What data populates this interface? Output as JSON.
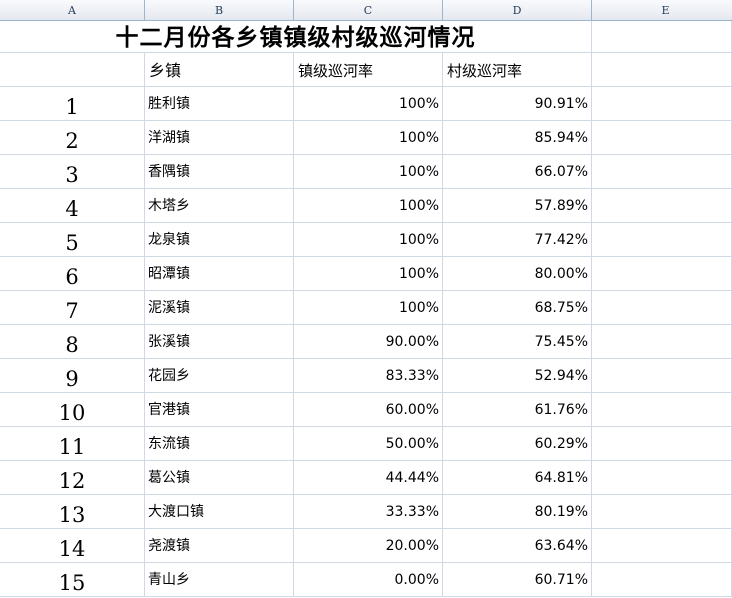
{
  "columns": [
    "A",
    "B",
    "C",
    "D",
    "E"
  ],
  "title": "十二月份各乡镇镇级村级巡河情况",
  "headers": {
    "index": "",
    "town": "乡镇",
    "town_rate": "镇级巡河率",
    "village_rate": "村级巡河率"
  },
  "rows": [
    {
      "idx": "1",
      "town": "胜利镇",
      "town_rate": "100%",
      "village_rate": "90.91%"
    },
    {
      "idx": "2",
      "town": "洋湖镇",
      "town_rate": "100%",
      "village_rate": "85.94%"
    },
    {
      "idx": "3",
      "town": "香隅镇",
      "town_rate": "100%",
      "village_rate": "66.07%"
    },
    {
      "idx": "4",
      "town": "木塔乡",
      "town_rate": "100%",
      "village_rate": "57.89%"
    },
    {
      "idx": "5",
      "town": "龙泉镇",
      "town_rate": "100%",
      "village_rate": "77.42%"
    },
    {
      "idx": "6",
      "town": "昭潭镇",
      "town_rate": "100%",
      "village_rate": "80.00%"
    },
    {
      "idx": "7",
      "town": "泥溪镇",
      "town_rate": "100%",
      "village_rate": "68.75%"
    },
    {
      "idx": "8",
      "town": "张溪镇",
      "town_rate": "90.00%",
      "village_rate": "75.45%"
    },
    {
      "idx": "9",
      "town": "花园乡",
      "town_rate": "83.33%",
      "village_rate": "52.94%"
    },
    {
      "idx": "10",
      "town": "官港镇",
      "town_rate": "60.00%",
      "village_rate": "61.76%"
    },
    {
      "idx": "11",
      "town": "东流镇",
      "town_rate": "50.00%",
      "village_rate": "60.29%"
    },
    {
      "idx": "12",
      "town": "葛公镇",
      "town_rate": "44.44%",
      "village_rate": "64.81%"
    },
    {
      "idx": "13",
      "town": "大渡口镇",
      "town_rate": "33.33%",
      "village_rate": "80.19%"
    },
    {
      "idx": "14",
      "town": "尧渡镇",
      "town_rate": "20.00%",
      "village_rate": "63.64%"
    },
    {
      "idx": "15",
      "town": "青山乡",
      "town_rate": "0.00%",
      "village_rate": "60.71%"
    }
  ]
}
